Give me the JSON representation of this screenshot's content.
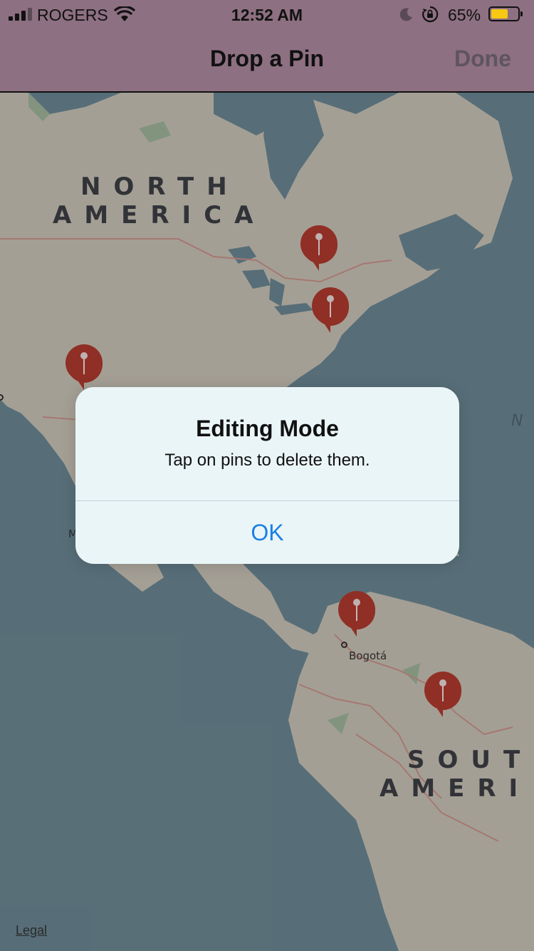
{
  "status": {
    "carrier": "ROGERS",
    "time": "12:52 AM",
    "battery": "65%",
    "battery_level_percent": 65,
    "icons": [
      "signal-icon",
      "wifi-icon",
      "moon-icon",
      "rotation-lock-icon",
      "battery-icon"
    ]
  },
  "nav": {
    "title": "Drop a Pin",
    "done_label": "Done"
  },
  "map": {
    "labels": {
      "north_line1": "NORTH",
      "north_line2": "AMERICA",
      "south_line1": "SOUT",
      "south_line2": "AMERI",
      "ocean_partial": "N",
      "partial_m": "M"
    },
    "city": "Bogotá",
    "legal": "Legal",
    "pin_count": 6
  },
  "alert": {
    "title": "Editing Mode",
    "message": "Tap on pins to delete them.",
    "ok_label": "OK"
  },
  "colors": {
    "bar_background": "#8d7081",
    "ocean": "#6b8793",
    "land": "#c9c3b6",
    "pin": "#b03a2e",
    "accent": "#1a7fe6"
  }
}
